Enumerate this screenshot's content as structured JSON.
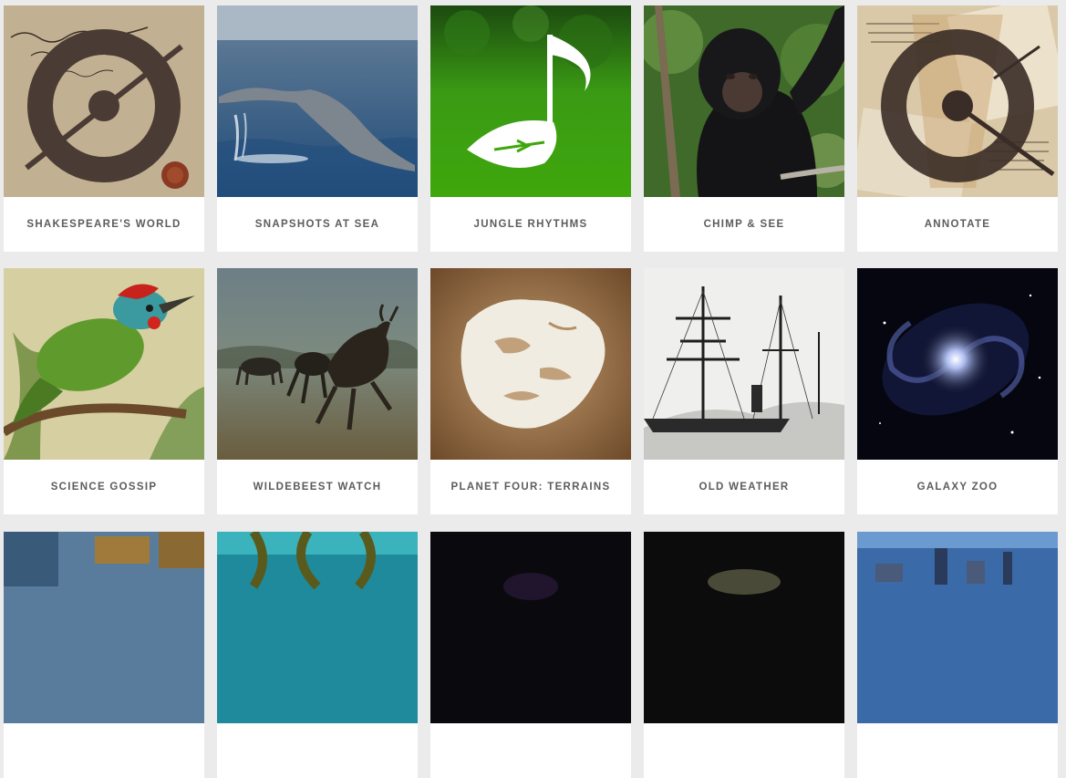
{
  "projects": [
    {
      "title": "SHAKESPEARE'S WORLD",
      "icon": "shakespeares-world-icon"
    },
    {
      "title": "SNAPSHOTS AT SEA",
      "icon": "whale-tail-image"
    },
    {
      "title": "JUNGLE RHYTHMS",
      "icon": "music-note-leaf-icon"
    },
    {
      "title": "CHIMP & SEE",
      "icon": "chimpanzee-image"
    },
    {
      "title": "ANNOTATE",
      "icon": "annotate-icon"
    },
    {
      "title": "SCIENCE GOSSIP",
      "icon": "bird-illustration-image"
    },
    {
      "title": "WILDEBEEST WATCH",
      "icon": "wildebeest-image"
    },
    {
      "title": "PLANET FOUR: TERRAINS",
      "icon": "mars-polar-cap-image"
    },
    {
      "title": "OLD WEATHER",
      "icon": "sailing-ship-image"
    },
    {
      "title": "GALAXY ZOO",
      "icon": "spiral-galaxy-image"
    }
  ],
  "colors": {
    "page_background": "#ebebeb",
    "card_background": "#ffffff",
    "label_text": "#5c5c5c",
    "jungle_green": "#3fa70c"
  }
}
